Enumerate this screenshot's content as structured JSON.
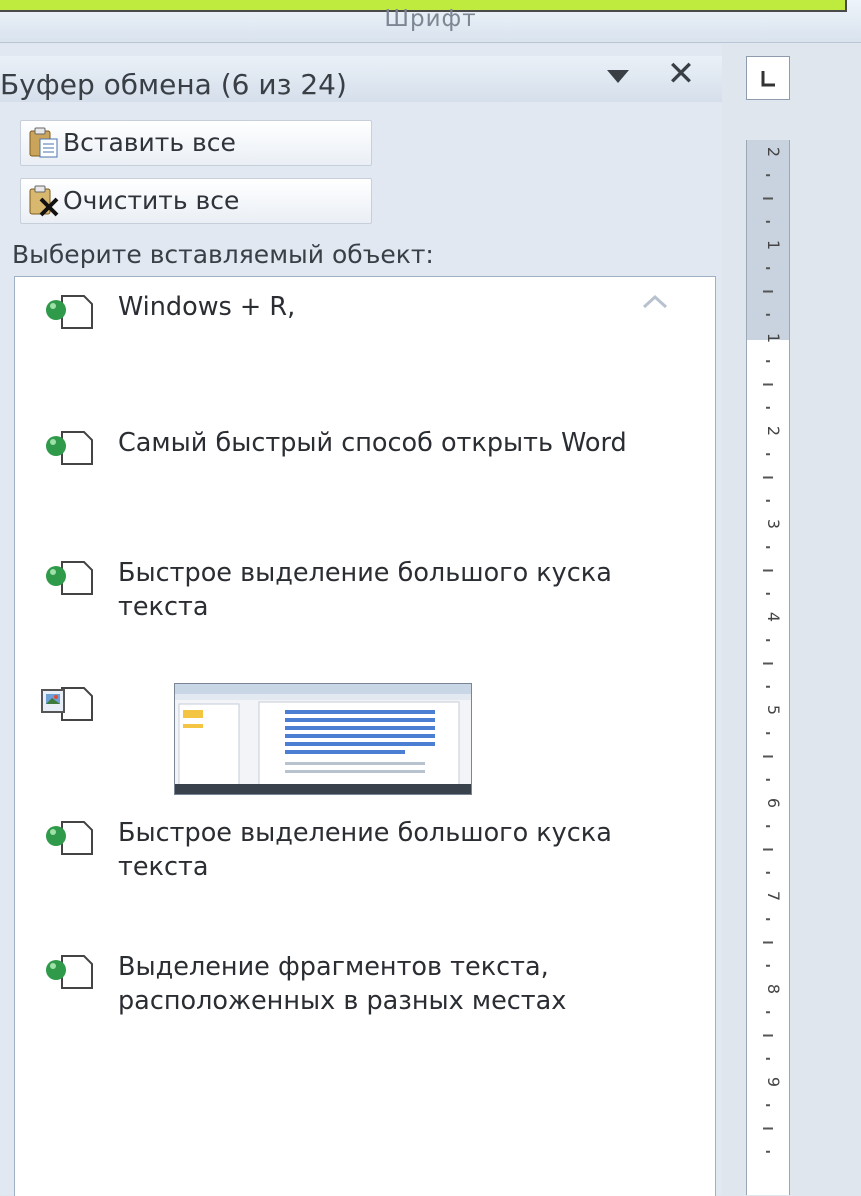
{
  "ribbon": {
    "group_label": "Шрифт"
  },
  "pane": {
    "title": "Буфер обмена (6 из 24)",
    "paste_all": "Вставить все",
    "clear_all": "Очистить все",
    "select_label": "Выберите вставляемый объект:",
    "items": [
      {
        "type": "text",
        "text": "Windows + R,"
      },
      {
        "type": "text",
        "text": "Самый быстрый способ открыть Word"
      },
      {
        "type": "text",
        "text": "Быстрое выделение большого куска текста"
      },
      {
        "type": "image",
        "text": ""
      },
      {
        "type": "text",
        "text": "Быстрое выделение большого куска текста"
      },
      {
        "type": "text",
        "text": "Выделение фрагментов текста, расположенных в разных местах"
      }
    ]
  },
  "ruler": {
    "numbers": [
      "2",
      "1",
      "1",
      "2",
      "3",
      "4",
      "5",
      "6",
      "7",
      "8",
      "9"
    ]
  },
  "colors": {
    "accent_green": "#bfea3e",
    "pane_bg": "#e1e8f1"
  },
  "icons": {
    "paste_all": "clipboard-paste-icon",
    "clear_all": "clear-clipboard-icon",
    "text_item": "text-clip-icon",
    "image_item": "image-clip-icon",
    "menu": "chevron-down-icon",
    "close": "close-icon"
  }
}
